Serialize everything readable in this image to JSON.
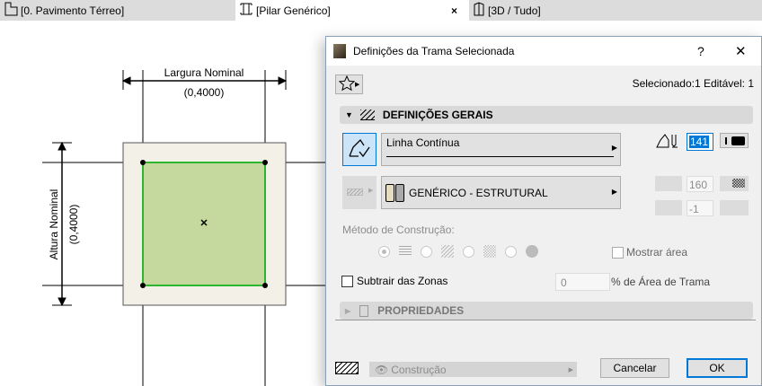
{
  "tabs": [
    {
      "label": "[0. Pavimento Térreo]",
      "icon": "floor-plan-icon"
    },
    {
      "label": "[Pilar Genérico]",
      "icon": "column-icon",
      "close": "×"
    },
    {
      "label": "[3D / Tudo]",
      "icon": "3d-icon"
    }
  ],
  "drawing": {
    "width_label": "Largura Nominal",
    "width_value": "(0,4000)",
    "height_label": "Altura Nominal",
    "height_value": "(0,4000)",
    "fill_color": "#c5d89e",
    "outline_color": "#2db52d"
  },
  "dialog": {
    "title": "Definições da Trama Selecionada",
    "help": "?",
    "close": "✕",
    "selection_info": "Selecionado:1 Editável: 1",
    "general_section": "DEFINIÇÕES GERAIS",
    "line_type": "Linha Contínua",
    "pen_value": "141",
    "fill_type": "GENÉRICO - ESTRUTURAL",
    "fill_pen": "160",
    "bg_pen": "-1",
    "construction_method_label": "Método de Construção:",
    "show_area": "Mostrar área",
    "subtract_zones": "Subtrair das Zonas",
    "area_percent_value": "0",
    "area_percent_label": "% de Área de Trama",
    "properties_section": "PROPRIEDADES",
    "layer": "Construção",
    "cancel": "Cancelar",
    "ok": "OK"
  }
}
